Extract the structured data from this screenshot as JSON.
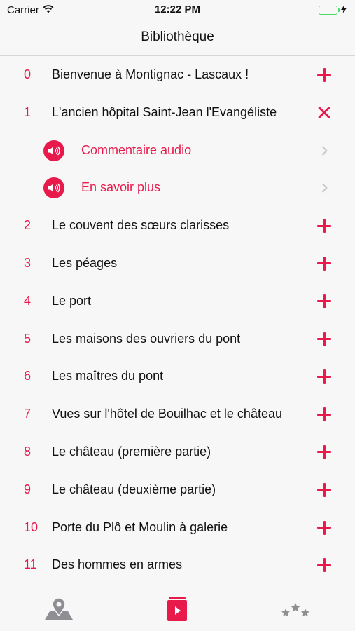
{
  "status_bar": {
    "carrier": "Carrier",
    "time": "12:22 PM",
    "battery_level": 1.0,
    "icons": [
      "wifi-icon",
      "battery-icon",
      "charging-bolt-icon"
    ]
  },
  "nav": {
    "title": "Bibliothèque"
  },
  "list": {
    "items": [
      {
        "number": "0",
        "title": "Bienvenue à Montignac - Lascaux !",
        "state": "collapsed"
      },
      {
        "number": "1",
        "title": "L'ancien hôpital Saint-Jean l'Evangéliste",
        "state": "expanded",
        "sub_items": [
          {
            "label": "Commentaire audio",
            "icon": "speaker-icon"
          },
          {
            "label": "En savoir plus",
            "icon": "speaker-icon"
          }
        ]
      },
      {
        "number": "2",
        "title": "Le couvent des sœurs clarisses",
        "state": "collapsed"
      },
      {
        "number": "3",
        "title": "Les péages",
        "state": "collapsed"
      },
      {
        "number": "4",
        "title": "Le port",
        "state": "collapsed"
      },
      {
        "number": "5",
        "title": "Les maisons des ouvriers du pont",
        "state": "collapsed"
      },
      {
        "number": "6",
        "title": "Les maîtres du pont",
        "state": "collapsed"
      },
      {
        "number": "7",
        "title": "Vues sur l'hôtel de Bouilhac et le château",
        "state": "collapsed"
      },
      {
        "number": "8",
        "title": "Le château (première partie)",
        "state": "collapsed"
      },
      {
        "number": "9",
        "title": "Le château (deuxième partie)",
        "state": "collapsed"
      },
      {
        "number": "10",
        "title": "Porte du Plô et Moulin à galerie",
        "state": "collapsed"
      },
      {
        "number": "11",
        "title": "Des hommes en armes",
        "state": "collapsed"
      }
    ]
  },
  "tab_bar": {
    "tabs": [
      {
        "icon": "map-pin-icon",
        "active": false
      },
      {
        "icon": "play-book-icon",
        "active": true
      },
      {
        "icon": "stars-icon",
        "active": false
      }
    ]
  },
  "colors": {
    "accent": "#e8194b",
    "text": "#111111",
    "background": "#f7f7f7",
    "separator": "#d7d7d7",
    "inactive_icon": "#8e8e93",
    "battery": "#4cd964"
  }
}
